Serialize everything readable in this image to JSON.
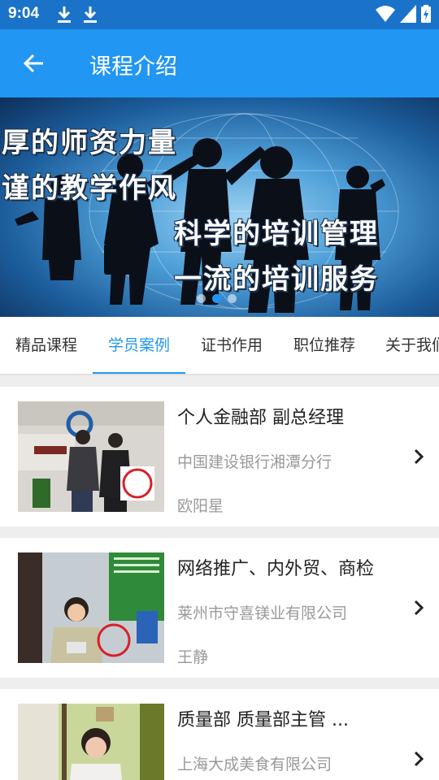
{
  "status_bar": {
    "time": "9:04"
  },
  "app_bar": {
    "title": "课程介绍"
  },
  "banner": {
    "lines": [
      "雄厚的师资力量",
      "严谨的教学作风",
      "科学的培训管理",
      "一流的培训服务"
    ],
    "active_slide": 2,
    "slide_count": 3
  },
  "tabs": {
    "items": [
      "精品课程",
      "学员案例",
      "证书作用",
      "职位推荐",
      "关于我们"
    ],
    "active": "学员案例"
  },
  "cases": [
    {
      "title": "个人金融部 副总经理",
      "company": "中国建设银行湘潭分行",
      "name": "欧阳星"
    },
    {
      "title": " 网络推广、内外贸、商检",
      "company": "莱州市守喜镁业有限公司",
      "name": "王静"
    },
    {
      "title": "质量部 质量部主管 ...",
      "company": "上海大成美食有限公司",
      "name": ""
    }
  ],
  "colors": {
    "status_bar": "#1a73c9",
    "app_bar": "#2196f3",
    "accent": "#2196f3"
  }
}
